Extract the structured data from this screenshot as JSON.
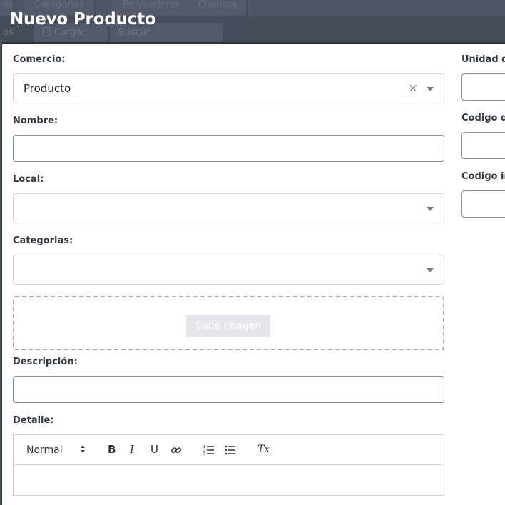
{
  "background": {
    "nav_tabs": [
      "os",
      "Categorias",
      "Proveedores",
      "Cuentas"
    ],
    "toolbar": {
      "prefix": "os",
      "load_label": "Cargar",
      "search_label": "Buscar"
    }
  },
  "modal": {
    "title": "Nuevo Producto",
    "left": {
      "comercio": {
        "label": "Comercio:",
        "value": "Producto"
      },
      "nombre": {
        "label": "Nombre:",
        "value": ""
      },
      "local": {
        "label": "Local:",
        "value": ""
      },
      "categorias": {
        "label": "Categorias:",
        "value": ""
      },
      "upload": {
        "label": "Sube Imagen"
      },
      "descripcion": {
        "label": "Descripción:",
        "value": ""
      },
      "detalle": {
        "label": "Detalle:",
        "format_value": "Normal"
      }
    },
    "right": {
      "unidad": {
        "label": "Unidad de"
      },
      "codigo_barras": {
        "label": "Codigo de"
      },
      "codigo_interno": {
        "label": "Codigo in"
      }
    }
  },
  "icons": {
    "clear": "×",
    "bold": "B",
    "italic": "I",
    "underline": "U",
    "clear_format": "Tx"
  }
}
